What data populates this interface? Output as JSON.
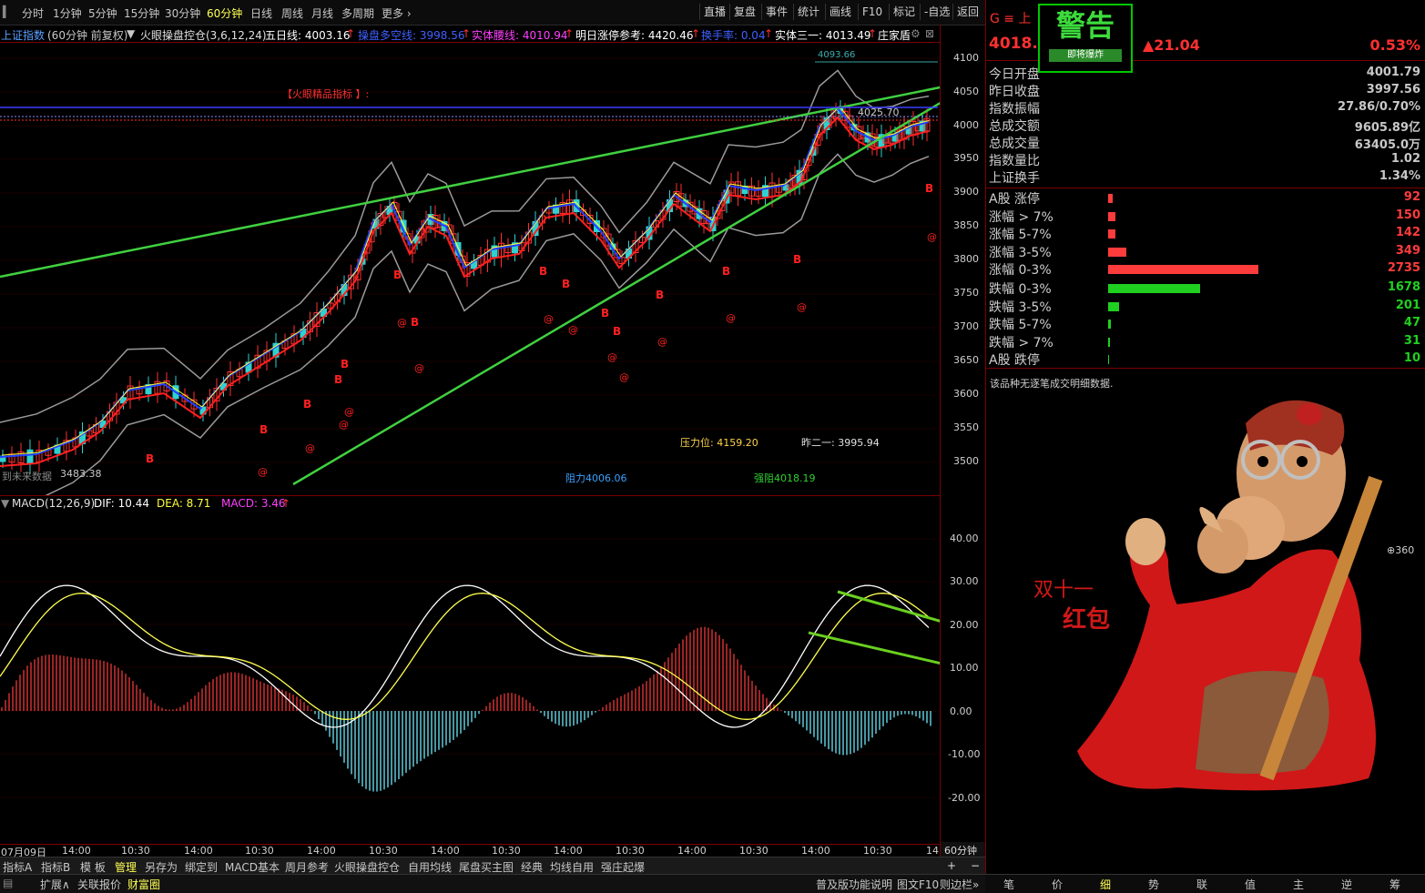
{
  "topbar": {
    "periods": [
      "分时",
      "1分钟",
      "5分钟",
      "15分钟",
      "30分钟",
      "60分钟",
      "日线",
      "周线",
      "月线",
      "多周期",
      "更多"
    ],
    "active_period": "60分钟",
    "right_buttons": [
      "直播",
      "复盘",
      "事件",
      "统计",
      "画线",
      "F10",
      "标记",
      "-自选",
      "返回"
    ]
  },
  "infobar": {
    "index_name": "上证指数",
    "period_label": "(60分钟 前复权)",
    "indicator": "火眼操盘控仓(3,6,12,24)",
    "ma5_label": "五日线: 4003.16",
    "bull_bear_label": "操盘多空线: 3998.56",
    "body_waist_label": "实体腰线: 4010.94",
    "limit_ref_label": "明日涨停参考: 4420.46",
    "turnover_label": "换手率: 0.04",
    "body_third_label": "实体三一: 4013.49",
    "dealer_label": "庄家盾"
  },
  "main_chart": {
    "title_tag": "【火眼精品指标 】:",
    "high_label": "4093.66",
    "mid_label": "4025.70",
    "low_label": "3483.38",
    "left_note": "到未来数据",
    "pressure_label": "压力位: 4159.20",
    "prev_label": "昨二一: 3995.94",
    "resist_label": "阻力4006.06",
    "strong_resist_label": "强阻4018.19",
    "y_ticks": [
      "4100",
      "4050",
      "4000",
      "3950",
      "3900",
      "3850",
      "3800",
      "3750",
      "3700",
      "3650",
      "3600",
      "3550",
      "3500"
    ]
  },
  "macd": {
    "label": "MACD(12,26,9)",
    "dif_label": "DIF: 10.44",
    "dea_label": "DEA: 8.71",
    "macd_label": "MACD: 3.46",
    "y_ticks": [
      "40.00",
      "30.00",
      "20.00",
      "10.00",
      "0.00",
      "-10.00",
      "-20.00"
    ]
  },
  "xaxis": {
    "labels": [
      "07月09日",
      "14:00",
      "10:30",
      "14:00",
      "10:30",
      "14:00",
      "10:30",
      "14:00",
      "10:30",
      "14:00",
      "10:30",
      "14:00",
      "10:30",
      "14:00",
      "10:30",
      "14"
    ],
    "period": "60分钟"
  },
  "tabs_row1": [
    "指标A",
    "指标B",
    "模 板",
    "管理",
    "另存为",
    "绑定到",
    "MACD基本",
    "周月参考",
    "火眼操盘控仓",
    "自用均线",
    "尾盘买主图",
    "经典",
    "均线自用",
    "强庄起爆"
  ],
  "tabs_row1_active": "管理",
  "tabs_row2": [
    "扩展∧",
    "关联报价",
    "财富圈"
  ],
  "tabs_row2_active": "财富圈",
  "tabs_row2_right": [
    "普及版功能说明",
    "图文F10",
    "则边栏»"
  ],
  "right_panel": {
    "code_prefix": "G ≡ 上",
    "price": "4018.",
    "change": "▲21.04",
    "change_pct": "0.53%",
    "warning_title": "警告",
    "warning_sub": "即将爆炸",
    "stats": [
      {
        "label": "今日开盘",
        "value": "4001.79",
        "color": "#ff3c3c"
      },
      {
        "label": "昨日收盘",
        "value": "3997.56",
        "color": "#ffffff"
      },
      {
        "label": "指数振幅",
        "value": "27.86/0.70%",
        "color": "#ffffff"
      },
      {
        "label": "总成交额",
        "value": "9605.89亿",
        "color": "#ffff3c"
      },
      {
        "label": "总成交量",
        "value": "63405.0万",
        "color": "#ffff3c"
      },
      {
        "label": "指数量比",
        "value": "1.02",
        "color": "#ff3c3c"
      },
      {
        "label": "上证换手",
        "value": "1.34%",
        "color": "#ffffff"
      }
    ],
    "ups": [
      {
        "label": "A股 涨停",
        "value": "92",
        "bar": 0.03
      },
      {
        "label": "涨幅 > 7%",
        "value": "150",
        "bar": 0.05
      },
      {
        "label": "涨幅 5-7%",
        "value": "142",
        "bar": 0.05
      },
      {
        "label": "涨幅 3-5%",
        "value": "349",
        "bar": 0.12
      },
      {
        "label": "涨幅 0-3%",
        "value": "2735",
        "bar": 1.0
      }
    ],
    "downs": [
      {
        "label": "跌幅 0-3%",
        "value": "1678",
        "bar": 0.61
      },
      {
        "label": "跌幅 3-5%",
        "value": "201",
        "bar": 0.07
      },
      {
        "label": "跌幅 5-7%",
        "value": "47",
        "bar": 0.02
      },
      {
        "label": "跌幅 > 7%",
        "value": "31",
        "bar": 0.01
      },
      {
        "label": "A股 跌停",
        "value": "10",
        "bar": 0.005
      }
    ],
    "note": "该品种无逐笔成交明细数据.",
    "promo_line1": "双十一",
    "promo_line2": "红包",
    "badge_360": "360",
    "tabs": [
      "笔",
      "价",
      "细",
      "势",
      "联",
      "值",
      "主",
      "逆",
      "筹"
    ],
    "active_tab": "细"
  }
}
